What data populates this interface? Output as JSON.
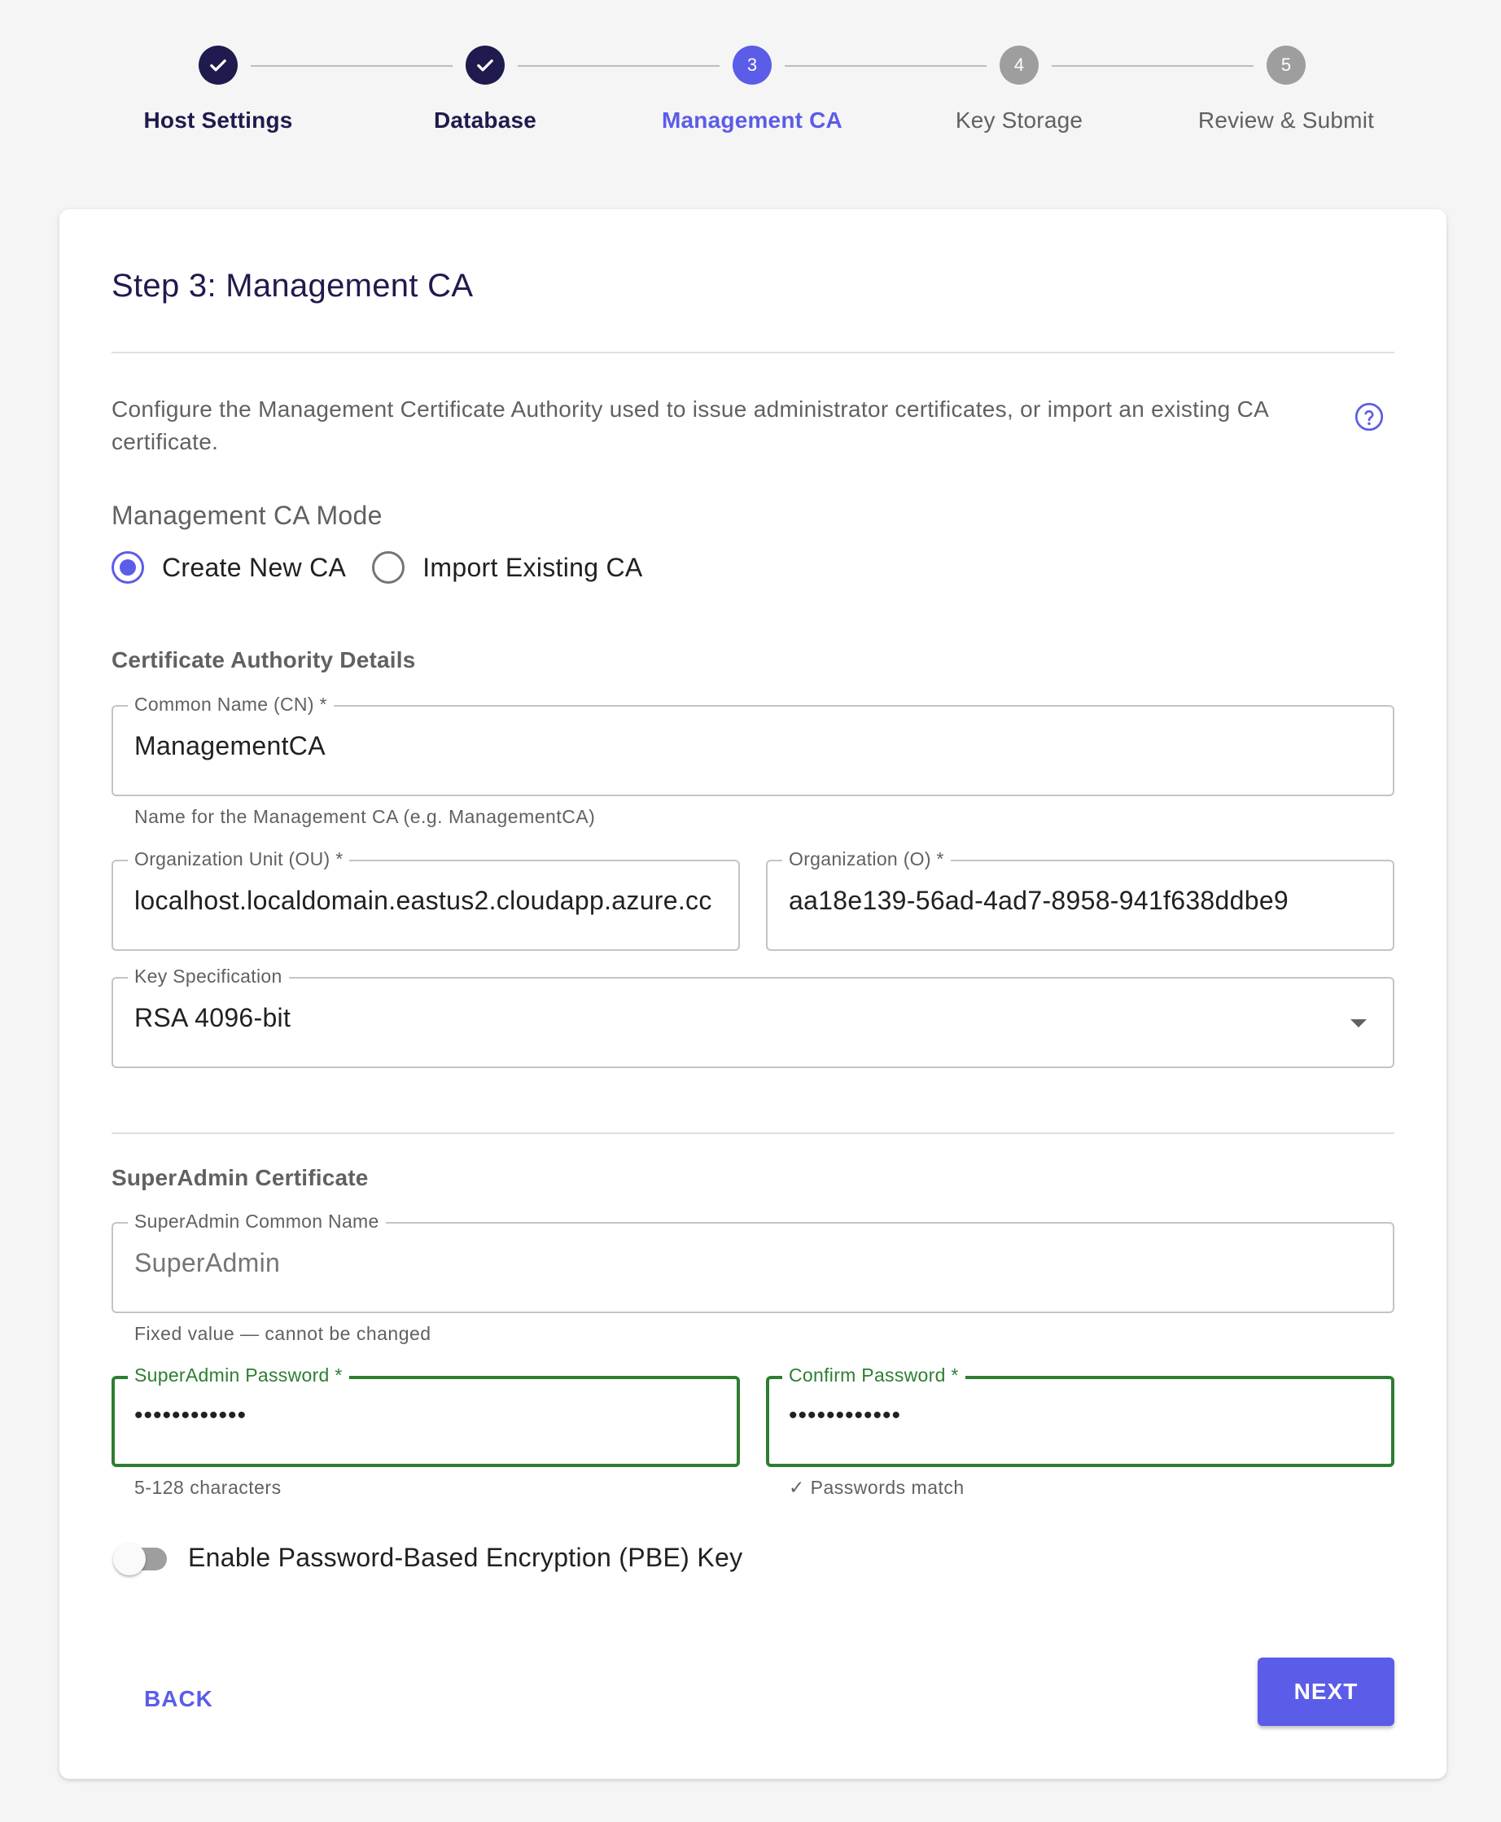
{
  "stepper": {
    "steps": [
      {
        "label": "Host Settings",
        "number": "1",
        "state": "done"
      },
      {
        "label": "Database",
        "number": "2",
        "state": "done"
      },
      {
        "label": "Management CA",
        "number": "3",
        "state": "active"
      },
      {
        "label": "Key Storage",
        "number": "4",
        "state": "todo"
      },
      {
        "label": "Review & Submit",
        "number": "5",
        "state": "todo"
      }
    ]
  },
  "card": {
    "title": "Step 3: Management CA",
    "description": "Configure the Management Certificate Authority used to issue administrator certificates, or import an existing CA certificate.",
    "help_icon": "help-circle-icon"
  },
  "mode": {
    "label": "Management CA Mode",
    "options": [
      {
        "label": "Create New CA",
        "checked": true
      },
      {
        "label": "Import Existing CA",
        "checked": false
      }
    ]
  },
  "ca_details": {
    "heading": "Certificate Authority Details",
    "common_name": {
      "label": "Common Name (CN) *",
      "value": "ManagementCA",
      "helper": "Name for the Management CA (e.g. ManagementCA)"
    },
    "org_unit": {
      "label": "Organization Unit (OU) *",
      "value": "localhost.localdomain.eastus2.cloudapp.azure.cc"
    },
    "organization": {
      "label": "Organization (O) *",
      "value": "aa18e139-56ad-4ad7-8958-941f638ddbe9"
    },
    "key_spec": {
      "label": "Key Specification",
      "value": "RSA 4096-bit"
    }
  },
  "superadmin": {
    "heading": "SuperAdmin Certificate",
    "common_name": {
      "label": "SuperAdmin Common Name",
      "value": "SuperAdmin",
      "helper": "Fixed value — cannot be changed"
    },
    "password": {
      "label": "SuperAdmin Password *",
      "value": "••••••••••••",
      "helper": "5-128 characters"
    },
    "confirm": {
      "label": "Confirm Password *",
      "value": "••••••••••••",
      "helper": "✓ Passwords match"
    }
  },
  "pbe": {
    "label": "Enable Password-Based Encryption (PBE) Key",
    "enabled": false
  },
  "actions": {
    "back": "BACK",
    "next": "NEXT"
  },
  "colors": {
    "primary": "#5b5ce8",
    "done": "#1f1b4e",
    "success": "#2e7d32",
    "pending": "#9e9e9e"
  }
}
